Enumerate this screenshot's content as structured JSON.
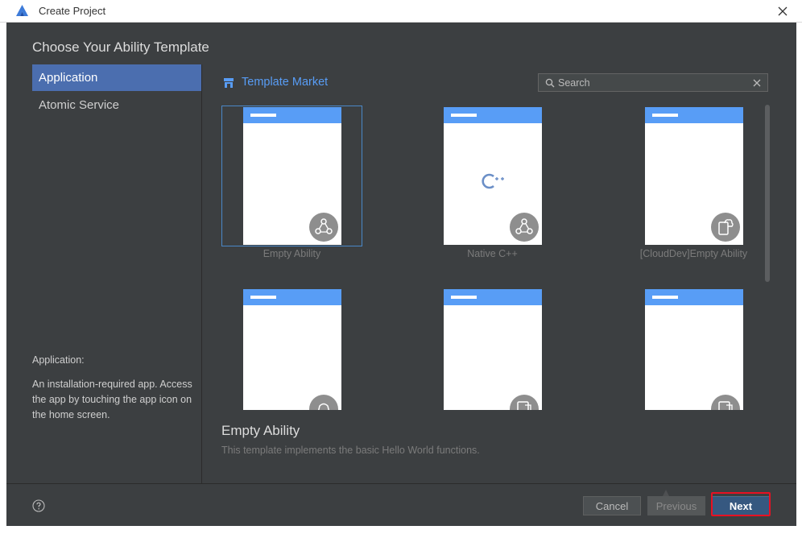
{
  "window": {
    "title": "Create Project",
    "app_icon": "deveco-logo-icon",
    "close_icon": "close-icon"
  },
  "dialog": {
    "title": "Choose Your Ability Template"
  },
  "sidebar": {
    "items": [
      {
        "label": "Application",
        "selected": true
      },
      {
        "label": "Atomic Service",
        "selected": false
      }
    ],
    "description_title": "Application:",
    "description": "An installation-required app. Access the app by touching the app icon on the home screen."
  },
  "market": {
    "label": "Template Market",
    "icon": "store-icon"
  },
  "search": {
    "placeholder": "Search",
    "value": "",
    "icon": "search-icon",
    "clear_icon": "clear-icon"
  },
  "templates": [
    {
      "label": "Empty Ability",
      "badge": "ability-icon",
      "selected": true
    },
    {
      "label": "Native C++",
      "badge": "ability-icon",
      "selected": false
    },
    {
      "label": "[CloudDev]Empty Ability",
      "badge": "cloud-device-icon",
      "selected": false
    },
    {
      "label": "",
      "badge": "stopwatch-icon",
      "selected": false
    },
    {
      "label": "",
      "badge": "device-code-icon",
      "selected": false
    },
    {
      "label": "",
      "badge": "device-code-icon",
      "selected": false
    }
  ],
  "detail": {
    "title": "Empty Ability",
    "description": "This template implements the basic Hello World functions."
  },
  "footer": {
    "help_icon": "help-icon",
    "cancel_label": "Cancel",
    "previous_label": "Previous",
    "next_label": "Next"
  },
  "colors": {
    "accent": "#589df6",
    "selection": "#4b6eaf",
    "background": "#3c3f41",
    "highlight": "#e81123"
  }
}
